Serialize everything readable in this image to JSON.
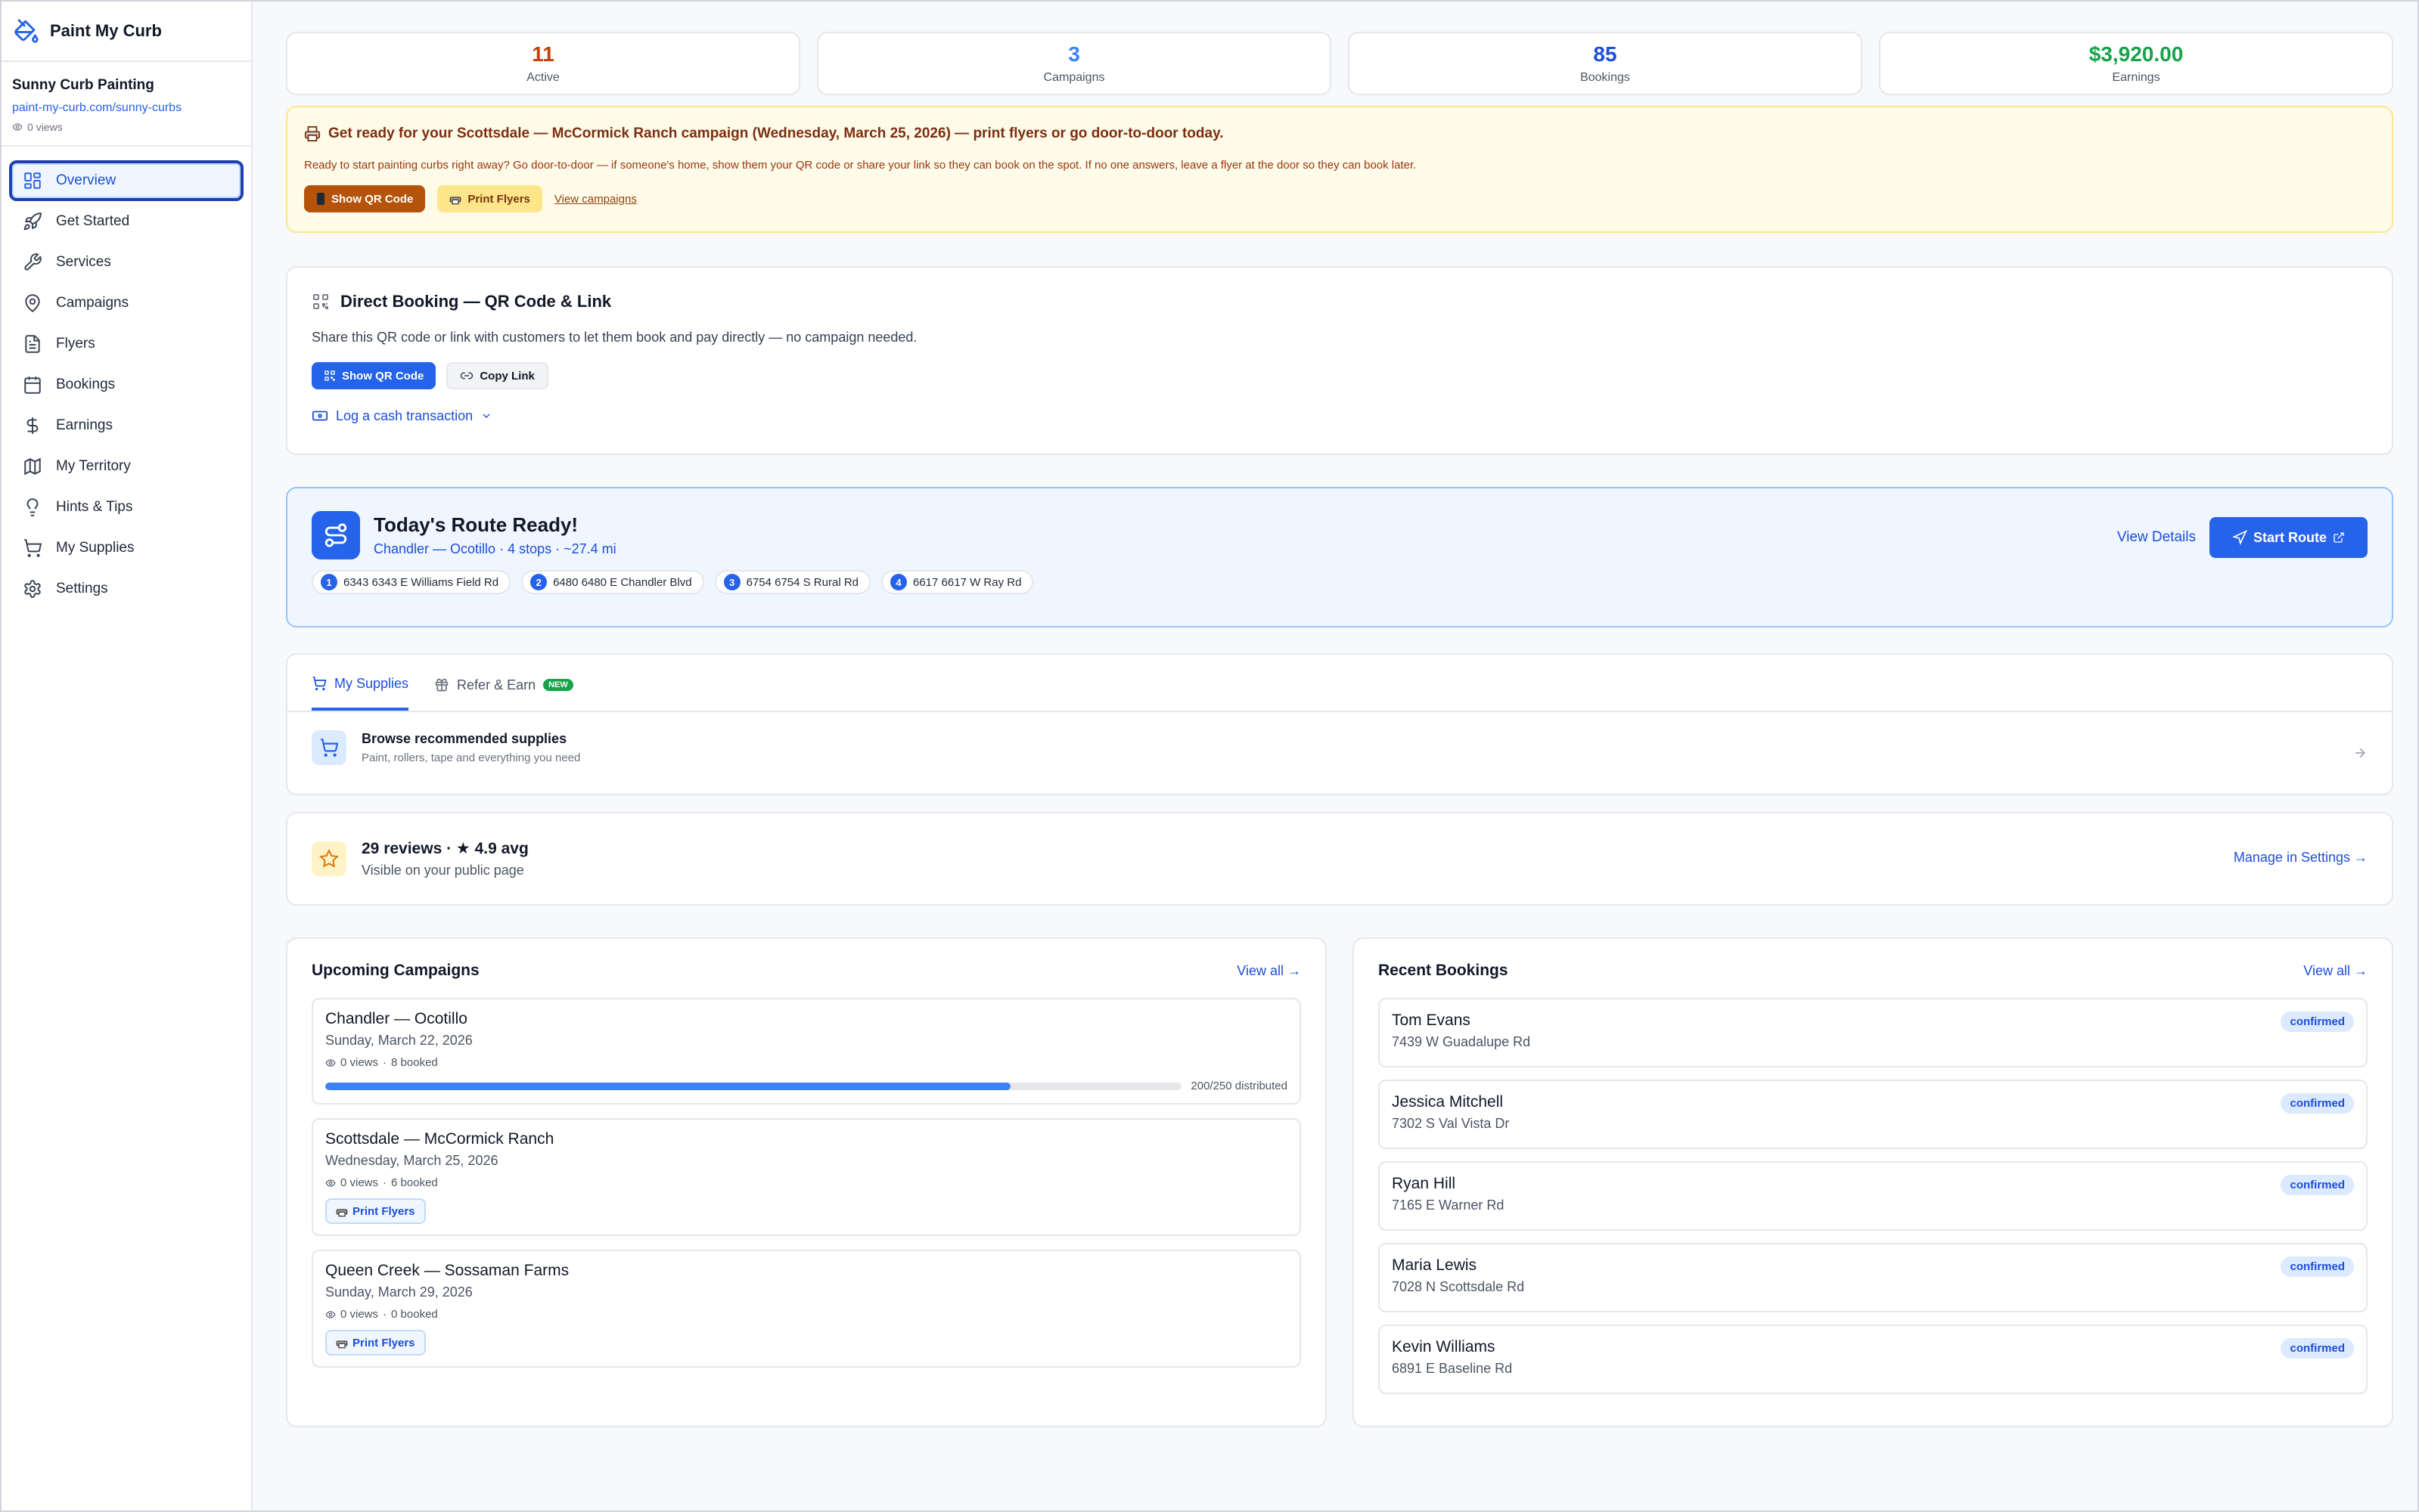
{
  "app": {
    "name": "Paint My Curb"
  },
  "business": {
    "name": "Sunny Curb Painting",
    "link": "paint-my-curb.com/sunny-curbs",
    "views": "0 views"
  },
  "nav": [
    {
      "label": "Overview",
      "icon": "grid-icon",
      "active": true
    },
    {
      "label": "Get Started",
      "icon": "rocket-icon"
    },
    {
      "label": "Services",
      "icon": "wrench-icon"
    },
    {
      "label": "Campaigns",
      "icon": "map-pin-icon"
    },
    {
      "label": "Flyers",
      "icon": "file-icon"
    },
    {
      "label": "Bookings",
      "icon": "calendar-icon"
    },
    {
      "label": "Earnings",
      "icon": "dollar-icon"
    },
    {
      "label": "My Territory",
      "icon": "map-icon"
    },
    {
      "label": "Hints & Tips",
      "icon": "lightbulb-icon"
    },
    {
      "label": "My Supplies",
      "icon": "cart-icon"
    },
    {
      "label": "Settings",
      "icon": "gear-icon"
    }
  ],
  "stats": [
    {
      "value": "11",
      "label": "Active",
      "color": "#c2410c"
    },
    {
      "value": "3",
      "label": "Campaigns",
      "color": "#3b82f6"
    },
    {
      "value": "85",
      "label": "Bookings",
      "color": "#1d4ed8"
    },
    {
      "value": "$3,920.00",
      "label": "Earnings",
      "color": "#16a34a"
    }
  ],
  "banner": {
    "title": "Get ready for your Scottsdale — McCormick Ranch campaign (Wednesday, March 25, 2026) — print flyers or go door-to-door today.",
    "text": "Ready to start painting curbs right away? Go door-to-door — if someone's home, show them your QR code or share your link so they can book on the spot. If no one answers, leave a flyer at the door so they can book later.",
    "show_qr": "Show QR Code",
    "print_flyers": "Print Flyers",
    "view_campaigns": "View campaigns"
  },
  "direct": {
    "title": "Direct Booking — QR Code & Link",
    "desc": "Share this QR code or link with customers to let them book and pay directly — no campaign needed.",
    "show_qr": "Show QR Code",
    "copy_link": "Copy Link",
    "log_cash": "Log a cash transaction"
  },
  "route": {
    "title": "Today's Route Ready!",
    "sub": "Chandler — Ocotillo · 4 stops · ~27.4 mi",
    "view_details": "View Details",
    "start": "Start Route",
    "stops": [
      {
        "n": "1",
        "addr": "6343 6343 E Williams Field Rd"
      },
      {
        "n": "2",
        "addr": "6480 6480 E Chandler Blvd"
      },
      {
        "n": "3",
        "addr": "6754 6754 S Rural Rd"
      },
      {
        "n": "4",
        "addr": "6617 6617 W Ray Rd"
      }
    ]
  },
  "supplies": {
    "tab1": "My Supplies",
    "tab2": "Refer & Earn",
    "tab2_badge": "NEW",
    "row_title": "Browse recommended supplies",
    "row_desc": "Paint, rollers, tape and everything you need"
  },
  "reviews": {
    "title": "29 reviews · ★ 4.9 avg",
    "desc": "Visible on your public page",
    "manage": "Manage in Settings →"
  },
  "campaigns": {
    "title": "Upcoming Campaigns",
    "view_all": "View all →",
    "items": [
      {
        "name": "Chandler — Ocotillo",
        "date": "Sunday, March 22, 2026",
        "views": "0 views",
        "booked": "8 booked",
        "progress": 0.8,
        "progress_label": "200/250 distributed"
      },
      {
        "name": "Scottsdale — McCormick Ranch",
        "date": "Wednesday, March 25, 2026",
        "views": "0 views",
        "booked": "6 booked",
        "button": "Print Flyers"
      },
      {
        "name": "Queen Creek — Sossaman Farms",
        "date": "Sunday, March 29, 2026",
        "views": "0 views",
        "booked": "0 booked",
        "button": "Print Flyers"
      }
    ]
  },
  "bookings": {
    "title": "Recent Bookings",
    "view_all": "View all →",
    "items": [
      {
        "name": "Tom Evans",
        "addr": "7439 W Guadalupe Rd",
        "status": "confirmed"
      },
      {
        "name": "Jessica Mitchell",
        "addr": "7302 S Val Vista Dr",
        "status": "confirmed"
      },
      {
        "name": "Ryan Hill",
        "addr": "7165 E Warner Rd",
        "status": "confirmed"
      },
      {
        "name": "Maria Lewis",
        "addr": "7028 N Scottsdale Rd",
        "status": "confirmed"
      },
      {
        "name": "Kevin Williams",
        "addr": "6891 E Baseline Rd",
        "status": "confirmed"
      }
    ]
  }
}
